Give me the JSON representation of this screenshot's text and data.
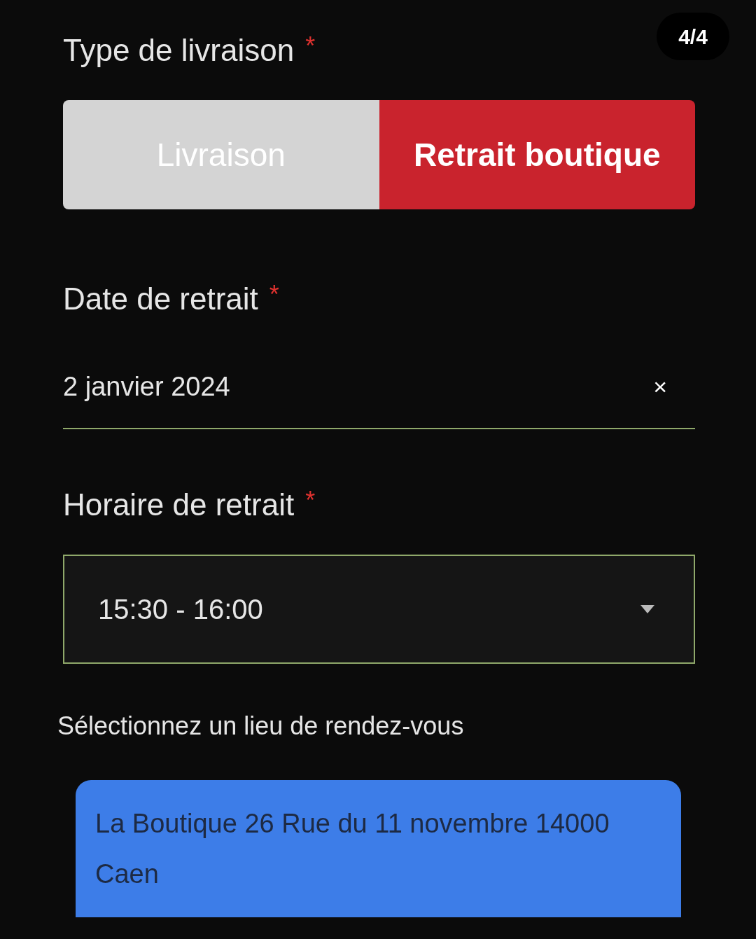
{
  "page_counter": "4/4",
  "delivery_type": {
    "label": "Type de livraison",
    "required_mark": "*",
    "options": [
      {
        "label": "Livraison",
        "selected": false
      },
      {
        "label": "Retrait boutique",
        "selected": true
      }
    ]
  },
  "pickup_date": {
    "label": "Date de retrait",
    "required_mark": "*",
    "value": "2 janvier 2024",
    "clear": "×"
  },
  "pickup_time": {
    "label": "Horaire de retrait",
    "required_mark": "*",
    "value": "15:30 - 16:00"
  },
  "location": {
    "prompt": "Sélectionnez un lieu de rendez-vous",
    "options": [
      {
        "label": "La Boutique 26 Rue du 11 novembre 14000 Caen",
        "selected": true
      }
    ]
  }
}
